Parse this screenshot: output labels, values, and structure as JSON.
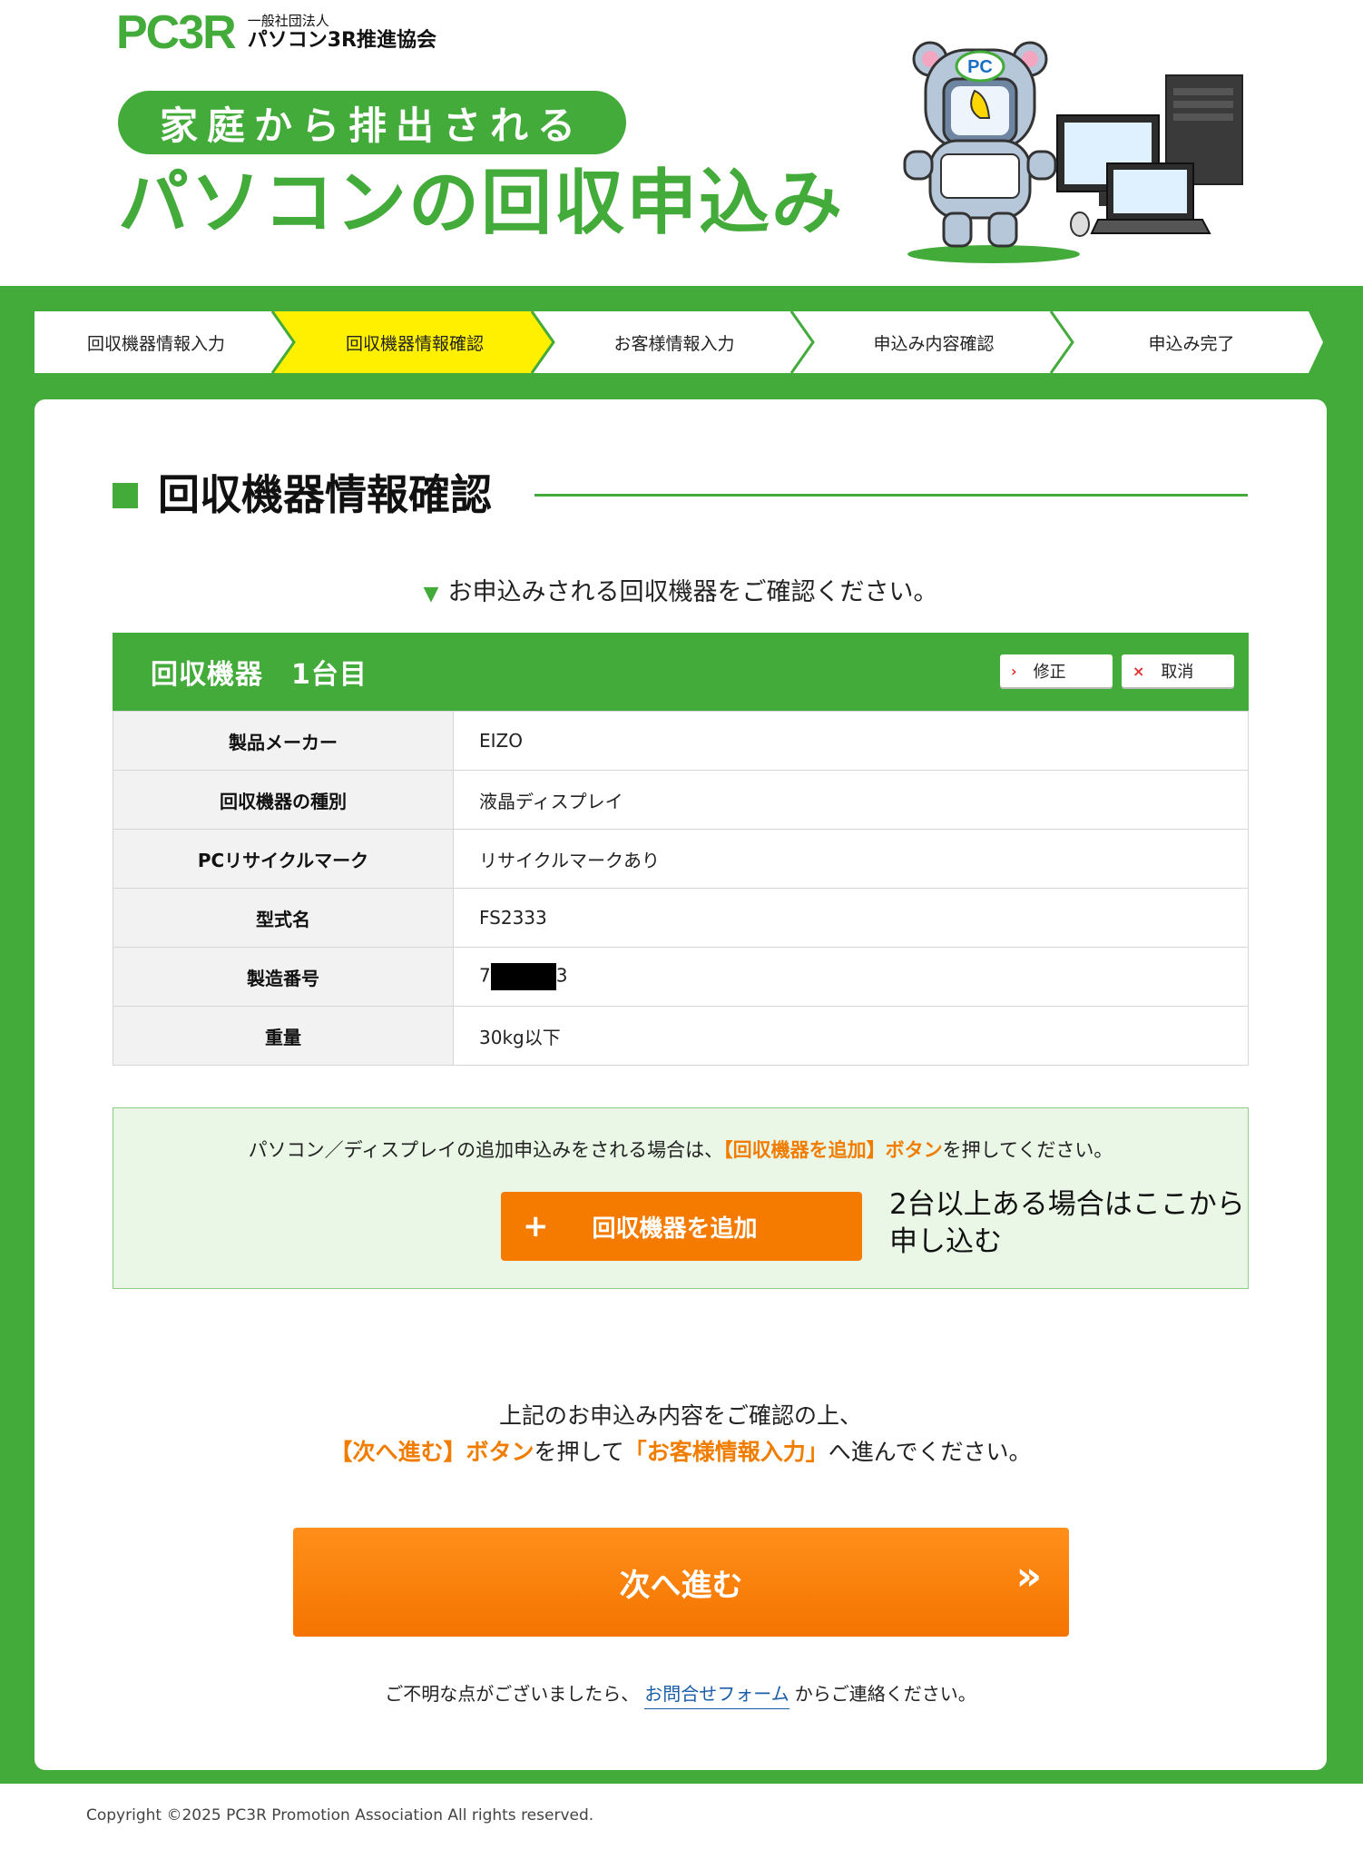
{
  "header": {
    "logo_mark": "PC3R",
    "logo_sub": "一般社団法人",
    "logo_main": "パソコン3R推進協会",
    "pill_text": "家庭から排出される",
    "title": "パソコンの回収申込み",
    "mascot_badge": "PC"
  },
  "steps": [
    {
      "label": "回収機器情報入力",
      "active": false
    },
    {
      "label": "回収機器情報確認",
      "active": true
    },
    {
      "label": "お客様情報入力",
      "active": false
    },
    {
      "label": "申込み内容確認",
      "active": false
    },
    {
      "label": "申込み完了",
      "active": false
    }
  ],
  "section_title": "回収機器情報確認",
  "lead": "お申込みされる回収機器をご確認ください。",
  "device": {
    "heading": "回収機器　1台目",
    "edit_label": "修正",
    "cancel_label": "取消",
    "rows": [
      {
        "key": "製品メーカー",
        "value": "EIZO"
      },
      {
        "key": "回収機器の種別",
        "value": "液晶ディスプレイ"
      },
      {
        "key": "PCリサイクルマーク",
        "value": "リサイクルマークあり"
      },
      {
        "key": "型式名",
        "value": "FS2333"
      },
      {
        "key": "製造番号",
        "value_prefix": "7",
        "value_suffix": "3"
      },
      {
        "key": "重量",
        "value": "30kg以下"
      }
    ]
  },
  "add": {
    "note_pre": "パソコン／ディスプレイの追加申込みをされる場合は、",
    "note_highlight": "【回収機器を追加】ボタン",
    "note_post": "を押してください。",
    "button_label": "回収機器を追加",
    "hint_line1": "2台以上ある場合はここから",
    "hint_line2": "申し込む"
  },
  "confirm": {
    "line1": "上記のお申込み内容をご確認の上、",
    "hl1": "【次へ進む】ボタン",
    "mid": "を押して",
    "hl2": "「お客様情報入力」",
    "end": "へ進んでください。"
  },
  "next_label": "次へ進む",
  "footer": {
    "pre": "ご不明な点がございましたら、",
    "link": "お問合せフォーム",
    "post": "からご連絡ください。"
  },
  "copyright": "Copyright ©2025 PC3R Promotion Association All rights reserved.",
  "colors": {
    "green": "#43ab3a",
    "orange": "#f47b00",
    "active_step": "#fff000"
  }
}
